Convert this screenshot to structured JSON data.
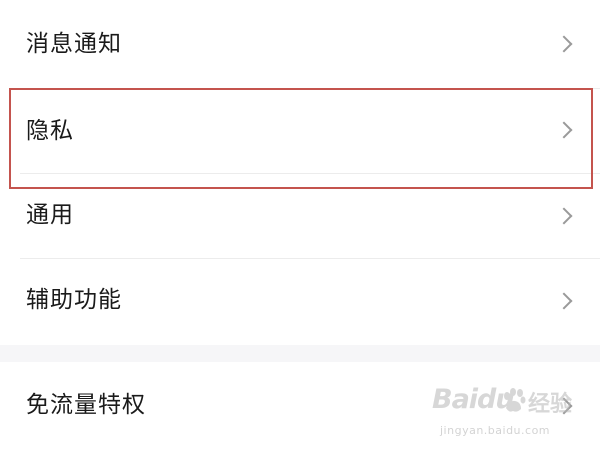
{
  "settings": {
    "items": [
      {
        "label": "消息通知"
      },
      {
        "label": "隐私"
      },
      {
        "label": "通用"
      },
      {
        "label": "辅助功能"
      },
      {
        "label": "免流量特权"
      }
    ]
  },
  "watermark": {
    "brand": "Baidu",
    "suffix": "经验",
    "url": "jingyan.baidu.com"
  },
  "colors": {
    "highlight": "#c4544e",
    "background": "#f6f6f8",
    "row": "#ffffff",
    "chevron": "#9a9a9a"
  },
  "icons": {
    "row_chevron": "chevron-right-icon",
    "watermark_logo": "baidu-paw-icon"
  }
}
